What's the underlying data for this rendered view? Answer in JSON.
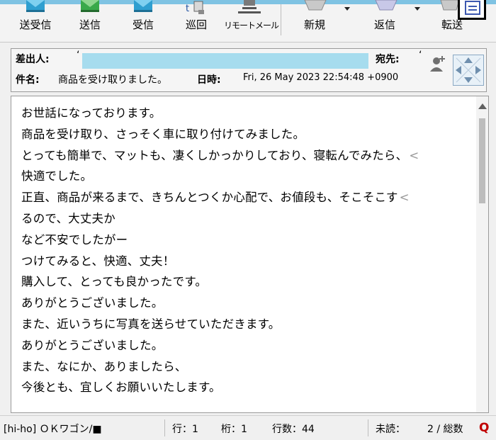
{
  "toolbar": {
    "buttons": [
      {
        "label": "送受信",
        "icon": "send-receive-icon"
      },
      {
        "label": "送信",
        "icon": "send-icon"
      },
      {
        "label": "受信",
        "icon": "receive-icon"
      },
      {
        "label": "巡回",
        "icon": "patrol-icon"
      },
      {
        "label": "リモートメール",
        "icon": "remote-mail-icon"
      },
      {
        "label": "新規",
        "icon": "new-mail-icon"
      },
      {
        "label": "返信",
        "icon": "reply-icon"
      },
      {
        "label": "転送",
        "icon": "forward-icon"
      }
    ],
    "accent_color": "#7fc3e3"
  },
  "header": {
    "from_label": "差出人:",
    "to_label": "宛先:",
    "subject_label": "件名:",
    "subject_value": "商品を受け取りました。",
    "date_label": "日時:",
    "date_value": "Fri, 26 May 2023 22:54:48 +0900",
    "redaction_color": "#a6dcee"
  },
  "body": {
    "lines": [
      {
        "text": "お世話になっております。",
        "wrap": false
      },
      {
        "text": "商品を受け取り、さっそく車に取り付けてみました。",
        "wrap": false
      },
      {
        "text": "とっても簡単で、マットも、凄くしかっかりしており、寝転んでみたら、",
        "wrap": true
      },
      {
        "text": "快適でした。",
        "wrap": false
      },
      {
        "text": "正直、商品が来るまで、きちんとつくか心配で、お値段も、そこそこす",
        "wrap": true
      },
      {
        "text": "るので、大丈夫か",
        "wrap": false
      },
      {
        "text": "など不安でしたがー",
        "wrap": false
      },
      {
        "text": "つけてみると、快適、丈夫！",
        "wrap": false
      },
      {
        "text": "購入して、とっても良かったです。",
        "wrap": false
      },
      {
        "text": "ありがとうございました。",
        "wrap": false
      },
      {
        "text": "また、近いうちに写真を送らせていただきます。",
        "wrap": false
      },
      {
        "text": "ありがとうございました。",
        "wrap": false
      },
      {
        "text": "また、なにか、ありましたら、",
        "wrap": false
      },
      {
        "text": "今後とも、宜しくお願いいたします。",
        "wrap": false
      }
    ],
    "wrap_marker": "<"
  },
  "status": {
    "account": "[hi-ho] ＯＫワゴン/■",
    "row": "行：1",
    "col": "桁：1",
    "line_count": "行数：44",
    "unread": "未読：",
    "unread_total": "2 / 総数",
    "q_icon": "Q"
  }
}
